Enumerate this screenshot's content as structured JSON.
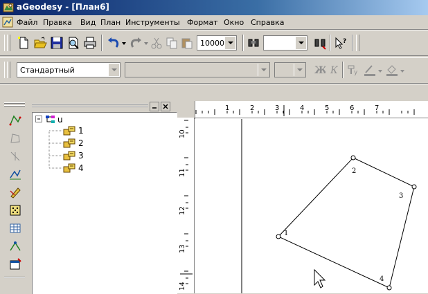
{
  "window": {
    "title": "aGeodesy - [План6]"
  },
  "menu": [
    "Файл",
    "Правка",
    "Вид",
    "План",
    "Инструменты",
    "Формат",
    "Окно",
    "Справка"
  ],
  "toolbar": {
    "zoom_value": "10000",
    "style_value": "Стандартный"
  },
  "tree": {
    "root": "u",
    "points": [
      "1",
      "2",
      "3",
      "4"
    ]
  },
  "ruler": {
    "top_labels": [
      "1",
      "2",
      "3",
      "4",
      "5",
      "6",
      "7"
    ],
    "left_labels": [
      "10",
      "11",
      "12",
      "13",
      "14"
    ]
  },
  "plan": {
    "point_labels": [
      "1",
      "2",
      "3",
      "4"
    ]
  },
  "colors": {
    "title_start": "#0a246a",
    "title_end": "#a6caf0",
    "face": "#d4d0c8"
  }
}
